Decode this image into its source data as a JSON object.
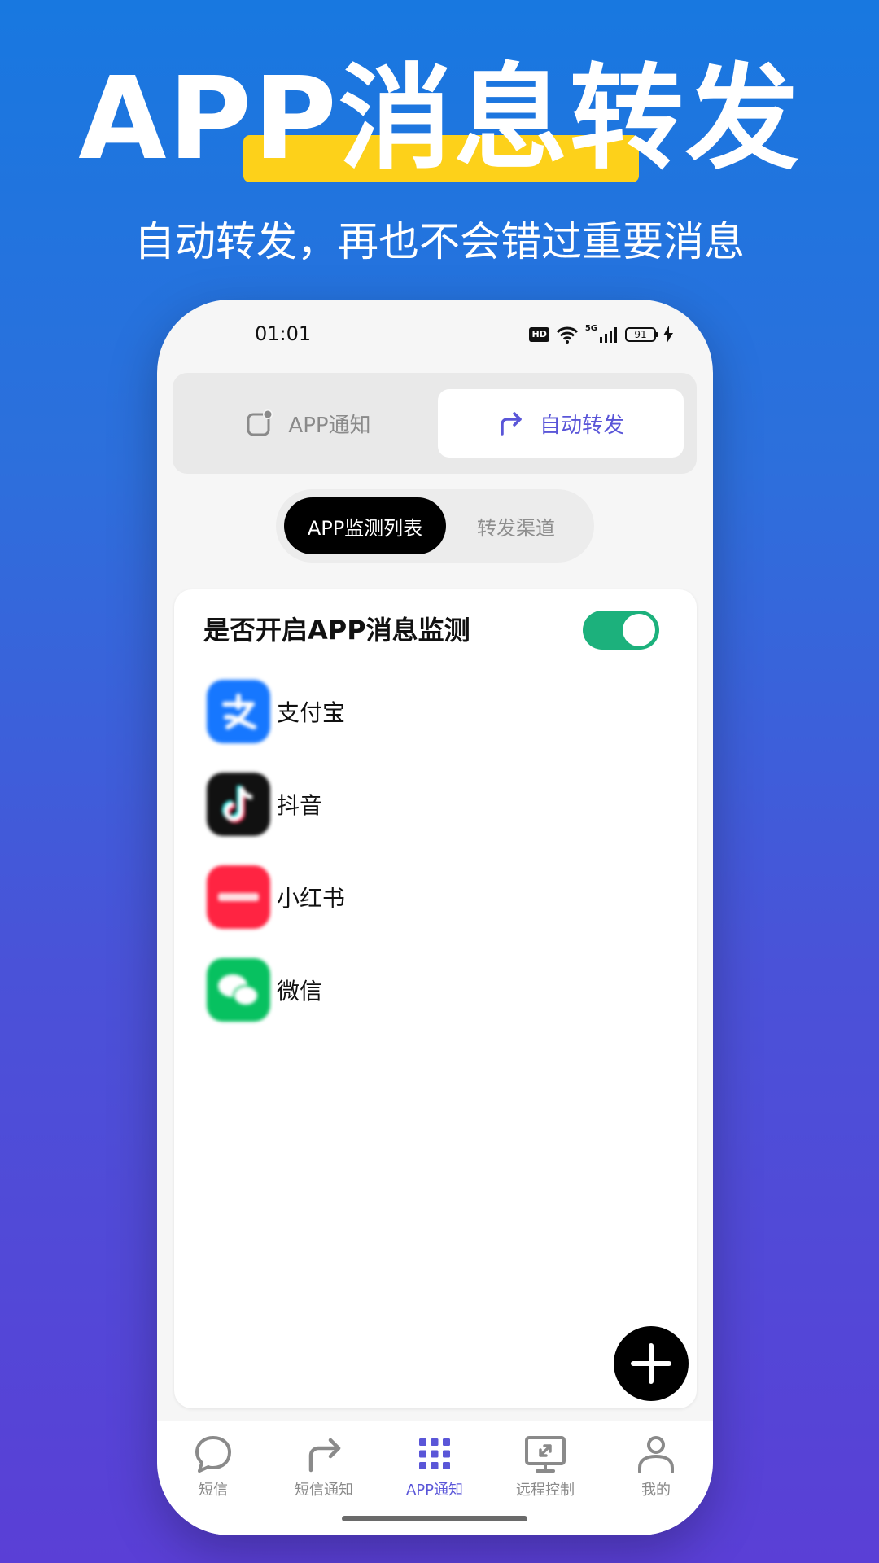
{
  "hero": {
    "title": "APP消息转发",
    "subtitle": "自动转发，再也不会错过重要消息"
  },
  "status_bar": {
    "time": "01:01",
    "hd": "HD",
    "network": "5G",
    "battery": "91"
  },
  "top_tabs": [
    {
      "label": "APP通知",
      "icon": "notification-badge-icon",
      "active": false
    },
    {
      "label": "自动转发",
      "icon": "forward-arrow-icon",
      "active": true
    }
  ],
  "sub_tabs": [
    {
      "label": "APP监测列表",
      "active": true
    },
    {
      "label": "转发渠道",
      "active": false
    }
  ],
  "card": {
    "title": "是否开启APP消息监测",
    "toggle_on": true,
    "apps": [
      {
        "label": "支付宝",
        "icon": "alipay-icon",
        "color": "#1677ff"
      },
      {
        "label": "抖音",
        "icon": "douyin-icon",
        "color": "#111111"
      },
      {
        "label": "小红书",
        "icon": "xiaohongshu-icon",
        "color": "#ff2442"
      },
      {
        "label": "微信",
        "icon": "wechat-icon",
        "color": "#07c160"
      }
    ]
  },
  "bottom_nav": [
    {
      "label": "短信",
      "icon": "chat-bubble-icon",
      "active": false
    },
    {
      "label": "短信通知",
      "icon": "forward-arrow-icon",
      "active": false
    },
    {
      "label": "APP通知",
      "icon": "app-grid-icon",
      "active": true
    },
    {
      "label": "远程控制",
      "icon": "remote-monitor-icon",
      "active": false
    },
    {
      "label": "我的",
      "icon": "user-icon",
      "active": false
    }
  ],
  "colors": {
    "accent": "#5a56d8",
    "toggle_on": "#1cb17c",
    "highlight": "#fdd11a"
  }
}
